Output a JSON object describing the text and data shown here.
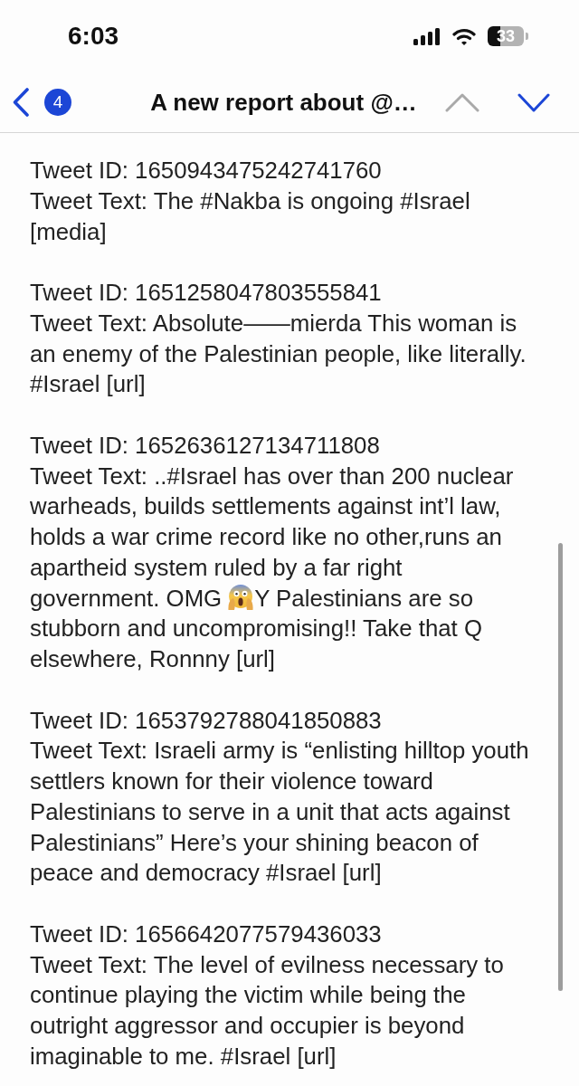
{
  "status_bar": {
    "time": "6:03",
    "battery": "33"
  },
  "nav_bar": {
    "unread_count": "4",
    "title": "A new report about @…",
    "buttons": [
      {
        "kind": "previous",
        "disabled": true
      },
      {
        "kind": "next",
        "disabled": false
      }
    ]
  },
  "tweets": [
    {
      "id": "Tweet ID: 1650943475242741760",
      "parts": [
        {
          "kind": "text",
          "text": "Tweet Text: The #Nakba is ongoing #Israel [media]"
        }
      ]
    },
    {
      "id": "Tweet ID: 1651258047803555841",
      "parts": [
        {
          "kind": "text",
          "text": "Tweet Text: Absolute——mierda This woman is an enemy of the Palestinian people, like literally. #Israel [url]"
        }
      ]
    },
    {
      "id": "Tweet ID: 1652636127134711808",
      "parts": [
        {
          "kind": "text",
          "text": "Tweet Text: ..#Israel has over than 200 nuclear warheads, builds settlements against int’l law, holds a war crime record like no other,runs an apartheid system ruled by a far right government. OMG"
        },
        {
          "kind": "emoji"
        },
        {
          "kind": "text",
          "text": "Y Palestinians are so stubborn and uncompromising!! Take that Q elsewhere, Ronnny [url]"
        }
      ]
    },
    {
      "id": "Tweet ID: 1653792788041850883",
      "parts": [
        {
          "kind": "text",
          "text": "Tweet Text: Israeli army is “enlisting hilltop youth settlers known for their violence toward Palestinians to serve in a unit that acts against Palestinians” Here’s your shining beacon of peace and democracy #Israel [url]"
        }
      ]
    },
    {
      "id": "Tweet ID: 1656642077579436033",
      "parts": [
        {
          "kind": "text",
          "text": "Tweet Text: The level of evilness necessary to continue playing the victim while being the outright aggressor and occupier is beyond imaginable to me. #Israel [url]"
        }
      ]
    }
  ]
}
